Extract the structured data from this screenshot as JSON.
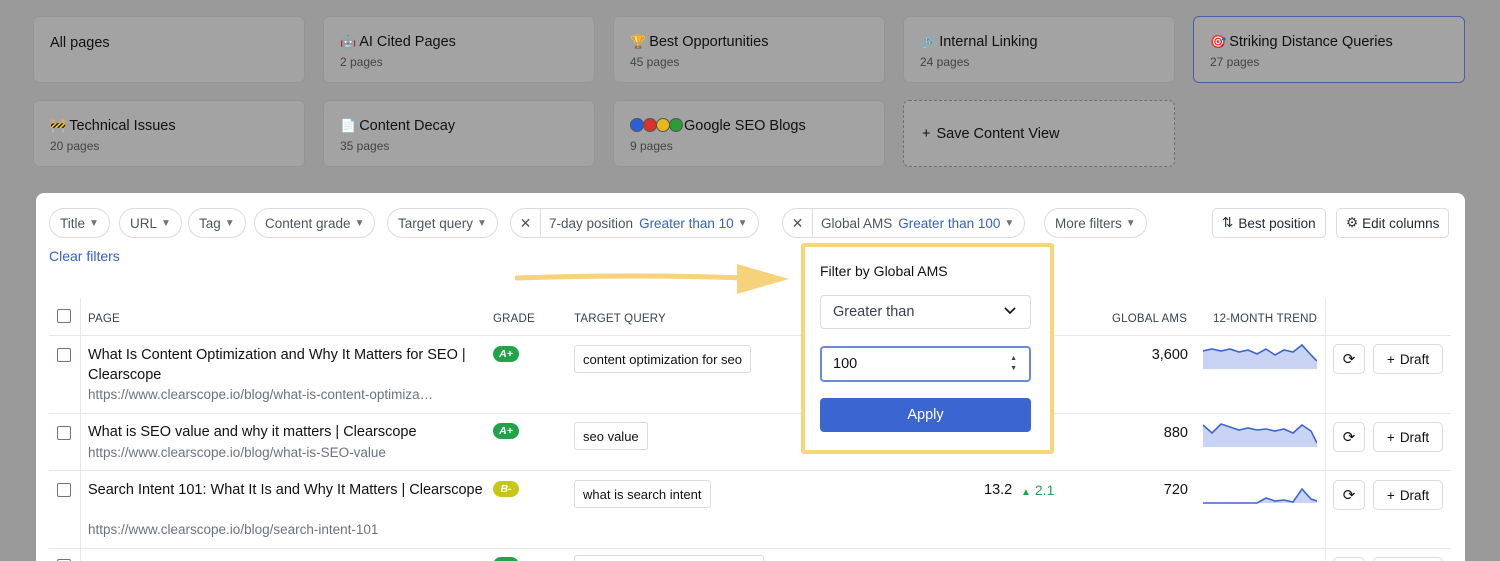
{
  "views": [
    {
      "title": "All pages",
      "subtitle": "",
      "icon": ""
    },
    {
      "title": "AI Cited Pages",
      "subtitle": "2 pages",
      "icon": "robot-icon"
    },
    {
      "title": "Best Opportunities",
      "subtitle": "45 pages",
      "icon": "trophy-icon"
    },
    {
      "title": "Internal Linking",
      "subtitle": "24 pages",
      "icon": "link-icon"
    },
    {
      "title": "Striking Distance Queries",
      "subtitle": "27 pages",
      "icon": "target-icon"
    },
    {
      "title": "Technical Issues",
      "subtitle": "20 pages",
      "icon": "construction-icon"
    },
    {
      "title": "Content Decay",
      "subtitle": "35 pages",
      "icon": "document-icon"
    },
    {
      "title": "Google SEO Blogs",
      "subtitle": "9 pages",
      "icon": "google-dots-icon"
    },
    {
      "title": "Save Content View",
      "subtitle": "",
      "icon": "plus-icon"
    }
  ],
  "filters": {
    "title": "Title",
    "url": "URL",
    "tag": "Tag",
    "grade": "Content grade",
    "query": "Target query",
    "position_label": "7-day position",
    "position_value": "Greater than 10",
    "ams_label": "Global AMS",
    "ams_value": "Greater than 100",
    "more": "More filters",
    "sort": "Best position",
    "edit": "Edit columns",
    "clear": "Clear filters"
  },
  "columns": {
    "page": "PAGE",
    "grade": "GRADE",
    "query": "TARGET QUERY",
    "ams": "GLOBAL AMS",
    "trend": "12-MONTH TREND"
  },
  "rows": [
    {
      "title": "What Is Content Optimization and Why It Matters for SEO | Clearscope",
      "url": "https://www.clearscope.io/blog/what-is-content-optimiza…",
      "grade": "A+",
      "query": "content optimization for seo",
      "position": "",
      "change": "",
      "ams": "3,600",
      "draft": "Draft"
    },
    {
      "title": "What is SEO value and why it matters | Clearscope",
      "url": "https://www.clearscope.io/blog/what-is-SEO-value",
      "grade": "A+",
      "query": "seo value",
      "position": "",
      "change": "",
      "ams": "880",
      "draft": "Draft"
    },
    {
      "title": "Search Intent 101: What It Is and Why It Matters | Clearscope",
      "url": "https://www.clearscope.io/blog/search-intent-101",
      "grade": "B-",
      "query": "what is search intent",
      "position": "13.2",
      "change": "2.1",
      "ams": "720",
      "draft": "Draft"
    }
  ],
  "popup": {
    "title": "Filter by Global AMS",
    "operator": "Greater than",
    "value": "100",
    "apply": "Apply"
  },
  "colors": {
    "accent": "#3b66d1",
    "grade_a": "#22a34a",
    "grade_b": "#c7c71a",
    "highlight": "#f5d77a"
  }
}
